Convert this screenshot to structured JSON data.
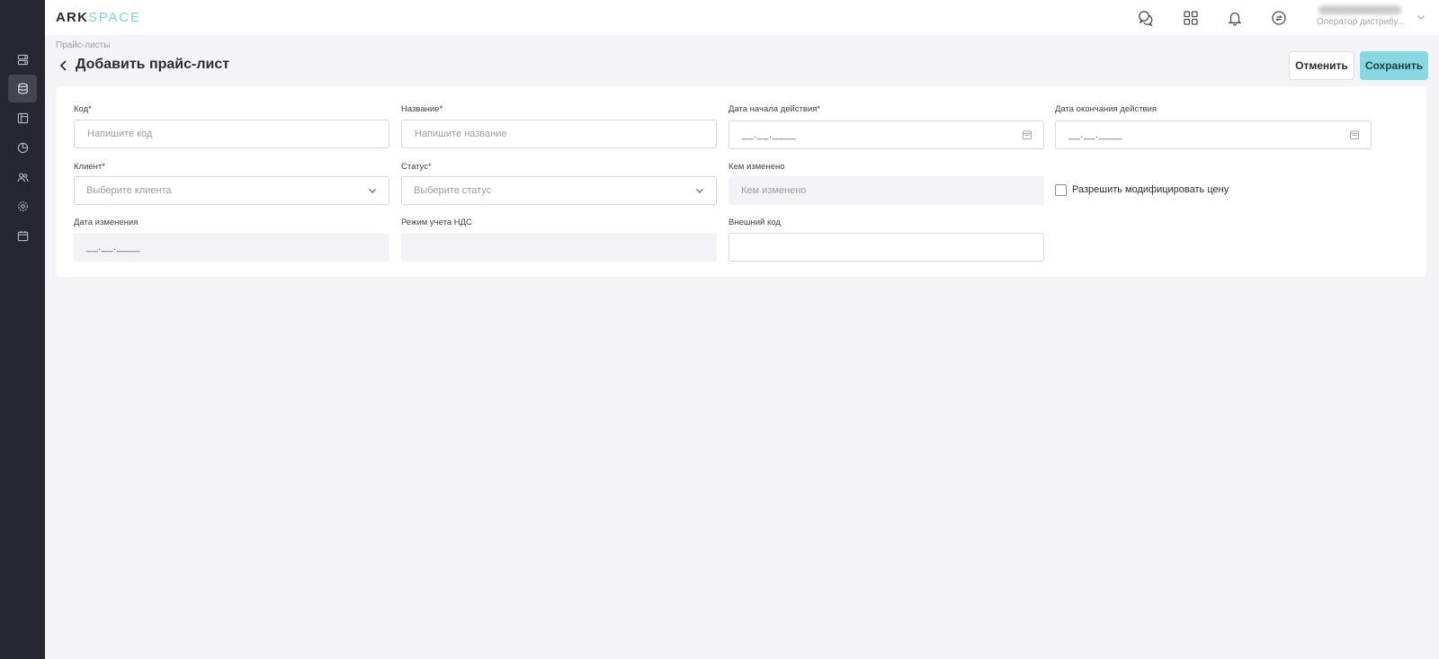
{
  "app": {
    "logo_main": "ARK",
    "logo_accent": "SPACE"
  },
  "sidebar": {
    "items": [
      {
        "icon": "server-icon",
        "active": false
      },
      {
        "icon": "database-icon",
        "active": true
      },
      {
        "icon": "layout-icon",
        "active": false
      },
      {
        "icon": "pie-chart-icon",
        "active": false
      },
      {
        "icon": "users-icon",
        "active": false
      },
      {
        "icon": "settings-icon",
        "active": false
      },
      {
        "icon": "calendar-icon",
        "active": false
      }
    ]
  },
  "topbar": {
    "icons": [
      "chat-icon",
      "apps-grid-icon",
      "bell-icon",
      "sync-icon"
    ],
    "user_role": "Оператор дистрибу..."
  },
  "header": {
    "breadcrumb": "Прайс-листы",
    "title": "Добавить прайс-лист",
    "cancel_label": "Отменить",
    "save_label": "Сохранить"
  },
  "form": {
    "code": {
      "label": "Код*",
      "placeholder": "Напишите код"
    },
    "name": {
      "label": "Название*",
      "placeholder": "Напишите название"
    },
    "start_date": {
      "label": "Дата начала действия*",
      "value": "__.__.____"
    },
    "end_date": {
      "label": "Дата окончания действия",
      "value": "__.__.____"
    },
    "client": {
      "label": "Клиент*",
      "placeholder": "Выберите клиента"
    },
    "status": {
      "label": "Статус*",
      "placeholder": "Выберите статус"
    },
    "changed_by": {
      "label": "Кем изменено",
      "placeholder": "Кем изменено"
    },
    "allow_price_modify": {
      "label": "Разрешить модифицировать цену",
      "checked": false
    },
    "changed_date": {
      "label": "Дата изменения",
      "value": "__.__.____"
    },
    "vat_mode": {
      "label": "Режим учета НДС",
      "value": ""
    },
    "external_code": {
      "label": "Внешний код",
      "value": ""
    }
  },
  "colors": {
    "sidebar_bg": "#27272f",
    "accent": "#86d8e2",
    "page_bg": "#f4f4f8"
  }
}
